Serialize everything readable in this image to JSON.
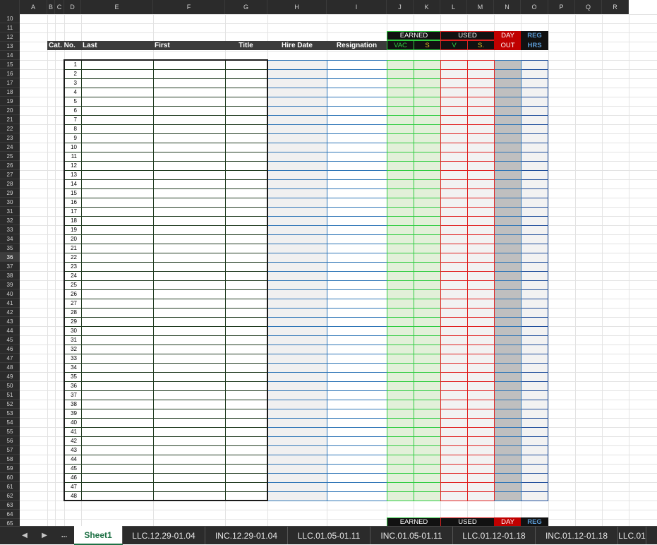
{
  "columns": [
    "A",
    "B",
    "C",
    "D",
    "E",
    "F",
    "G",
    "H",
    "I",
    "J",
    "K",
    "L",
    "M",
    "N",
    "O",
    "P",
    "Q",
    "R"
  ],
  "rows": [
    "10",
    "11",
    "12",
    "13",
    "14",
    "15",
    "16",
    "17",
    "18",
    "19",
    "20",
    "21",
    "22",
    "23",
    "24",
    "25",
    "26",
    "27",
    "28",
    "29",
    "30",
    "31",
    "32",
    "33",
    "34",
    "35",
    "36",
    "37",
    "38",
    "39",
    "40",
    "41",
    "42",
    "43",
    "44",
    "45",
    "46",
    "47",
    "48",
    "49",
    "50",
    "51",
    "52",
    "53",
    "54",
    "55",
    "56",
    "57",
    "58",
    "59",
    "60",
    "61",
    "62",
    "63",
    "64",
    "65"
  ],
  "selected_row": "36",
  "header": {
    "cat_no": "Cat. No.",
    "last": "Last",
    "first": "First",
    "title": "Title",
    "hire_date": "Hire Date",
    "resignation": "Resignation",
    "earned": "EARNED",
    "vac": "VAC",
    "s": "S",
    "used": "USED",
    "v": "V",
    "s_used": "S.",
    "day": "DAY",
    "out": "OUT",
    "reg": "REG",
    "hrs": "HRS"
  },
  "entry_numbers": [
    "1",
    "2",
    "3",
    "4",
    "5",
    "6",
    "7",
    "8",
    "9",
    "10",
    "11",
    "12",
    "13",
    "14",
    "15",
    "16",
    "17",
    "18",
    "19",
    "20",
    "21",
    "22",
    "23",
    "24",
    "25",
    "26",
    "27",
    "28",
    "29",
    "30",
    "31",
    "32",
    "33",
    "34",
    "35",
    "36",
    "37",
    "38",
    "39",
    "40",
    "41",
    "42",
    "43",
    "44",
    "45",
    "46",
    "47",
    "48"
  ],
  "lower_block": {
    "earned": "EARNED",
    "used": "USED",
    "day": "DAY",
    "reg": "REG"
  },
  "tabs": {
    "nav_prev": "◀",
    "nav_next": "▶",
    "more": "...",
    "sheets": [
      "Sheet1",
      "LLC.12.29-01.04",
      "INC.12.29-01.04",
      "LLC.01.05-01.11",
      "INC.01.05-01.11",
      "LLC.01.12-01.18",
      "INC.01.12-01.18",
      "LLC.01"
    ],
    "active": "Sheet1"
  },
  "colors": {
    "earned_green": "#2ecc40",
    "used_red": "#e02020",
    "day_red": "#c00000",
    "reg_blue": "#5b9bd5",
    "tab_active_green": "#1e7145"
  }
}
